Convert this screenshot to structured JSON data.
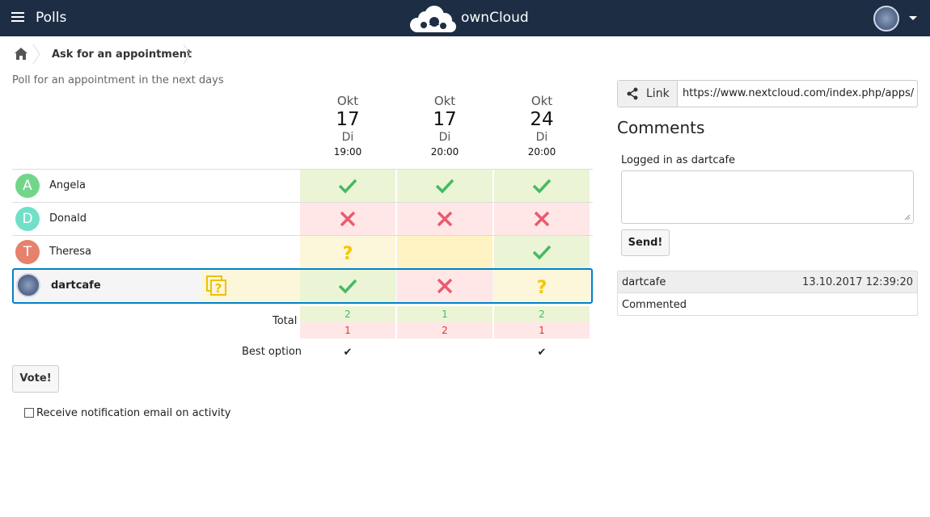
{
  "header": {
    "app_title": "Polls",
    "brand": "ownCloud"
  },
  "breadcrumb": {
    "current": "Ask for an appointment"
  },
  "poll": {
    "description": "Poll for an appointment in the next days",
    "dates": [
      {
        "month": "Okt",
        "day": "17",
        "weekday": "Di",
        "time": "19:00"
      },
      {
        "month": "Okt",
        "day": "17",
        "weekday": "Di",
        "time": "20:00"
      },
      {
        "month": "Okt",
        "day": "24",
        "weekday": "Di",
        "time": "20:00"
      }
    ],
    "participants": [
      {
        "initial": "A",
        "name": "Angela",
        "color": "#72d68a",
        "votes": [
          "yes",
          "yes",
          "yes"
        ]
      },
      {
        "initial": "D",
        "name": "Donald",
        "color": "#72e0c8",
        "votes": [
          "no",
          "no",
          "no"
        ]
      },
      {
        "initial": "T",
        "name": "Theresa",
        "color": "#e6816d",
        "votes": [
          "maybe",
          "",
          "yes"
        ]
      }
    ],
    "current_user": {
      "name": "dartcafe",
      "votes": [
        "yes",
        "no",
        "maybe"
      ]
    },
    "totals": {
      "label": "Total",
      "yes": [
        "2",
        "1",
        "2"
      ],
      "no": [
        "1",
        "2",
        "1"
      ]
    },
    "best_option": {
      "label": "Best option",
      "marks": [
        "✔",
        "",
        "✔"
      ]
    },
    "vote_button": "Vote!",
    "notify_label": "Receive notification email on activity"
  },
  "share": {
    "button_label": "Link",
    "url": "https://www.nextcloud.com/index.php/apps/polls/poll/..."
  },
  "comments": {
    "title": "Comments",
    "logged_in_as": "Logged in as dartcafe",
    "textarea_value": "",
    "send_button": "Send!",
    "items": [
      {
        "author": "dartcafe",
        "date": "13.10.2017 12:39:20",
        "text": "Commented"
      }
    ]
  },
  "colors": {
    "header_bg": "#1d2d44",
    "yes": "#46ba61",
    "no": "#e9322d",
    "maybe": "#f0db0e",
    "accent": "#0082c9"
  },
  "icons": [
    "menu-icon",
    "owncloud-logo",
    "home-icon",
    "share-icon",
    "check-icon",
    "cross-icon",
    "question-icon",
    "toggle-all-icon"
  ]
}
